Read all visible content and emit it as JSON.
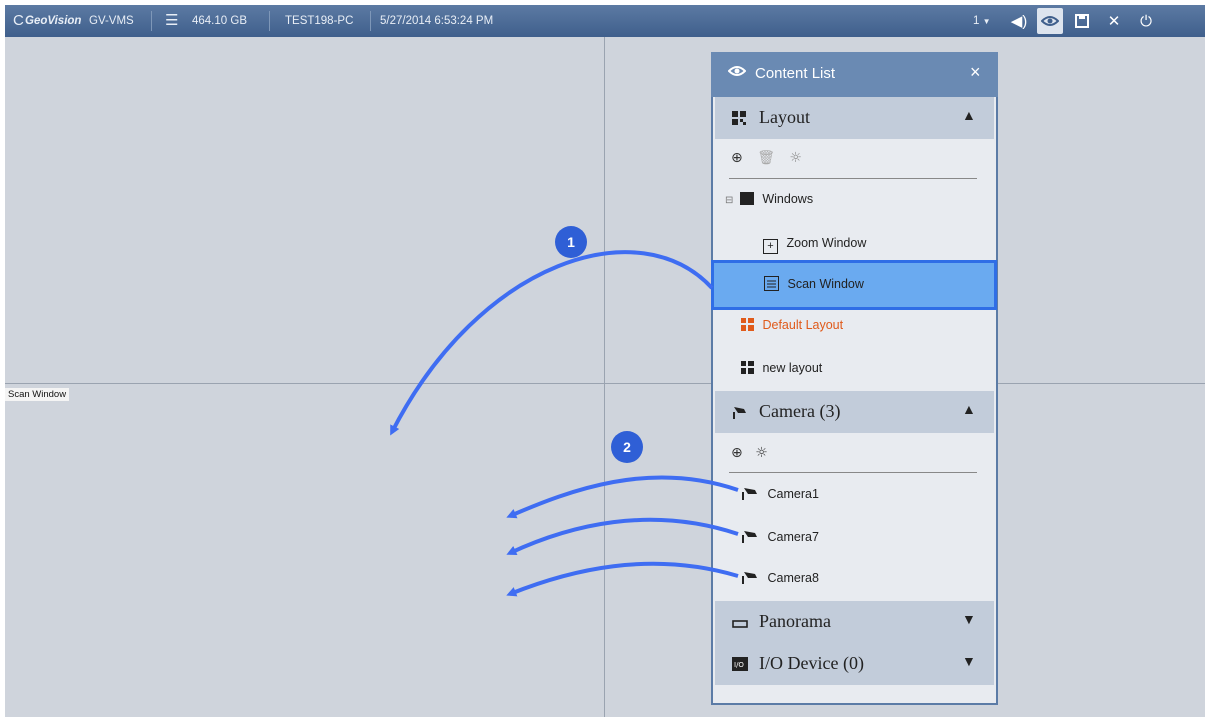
{
  "topbar": {
    "brand": "GeoVision",
    "product": "GV-VMS",
    "storage": "464.10 GB",
    "pc_name": "TEST198-PC",
    "datetime": "5/27/2014 6:53:24 PM",
    "page_selector": "1",
    "icons": [
      "geovision-logo-icon",
      "storage-icon",
      "speaker-icon",
      "eye-icon",
      "save-icon",
      "tools-icon",
      "power-icon"
    ]
  },
  "canvas": {
    "scan_window_label": "Scan Window"
  },
  "content_list": {
    "title": "Content List",
    "sections": {
      "layout": {
        "label": "Layout"
      },
      "camera": {
        "label": "Camera (3)"
      },
      "panorama": {
        "label": "Panorama"
      },
      "io_device": {
        "label": "I/O Device (0)"
      }
    },
    "layout_tree": {
      "windows": "Windows",
      "zoom_window": "Zoom Window",
      "scan_window": "Scan Window",
      "default_layout": "Default Layout",
      "new_layout": "new layout"
    },
    "cameras": [
      "Camera1",
      "Camera7",
      "Camera8"
    ]
  },
  "callouts": [
    "1",
    "2"
  ],
  "colors": {
    "topbar": "#4a6a96",
    "panel_header": "#6a8ab3",
    "selection": "#6aaaf0",
    "highlight_border": "#2f6ee6",
    "default_layout_text": "#e05a1a",
    "arrow": "#3f6df2",
    "canvas": "#cfd4dc"
  }
}
